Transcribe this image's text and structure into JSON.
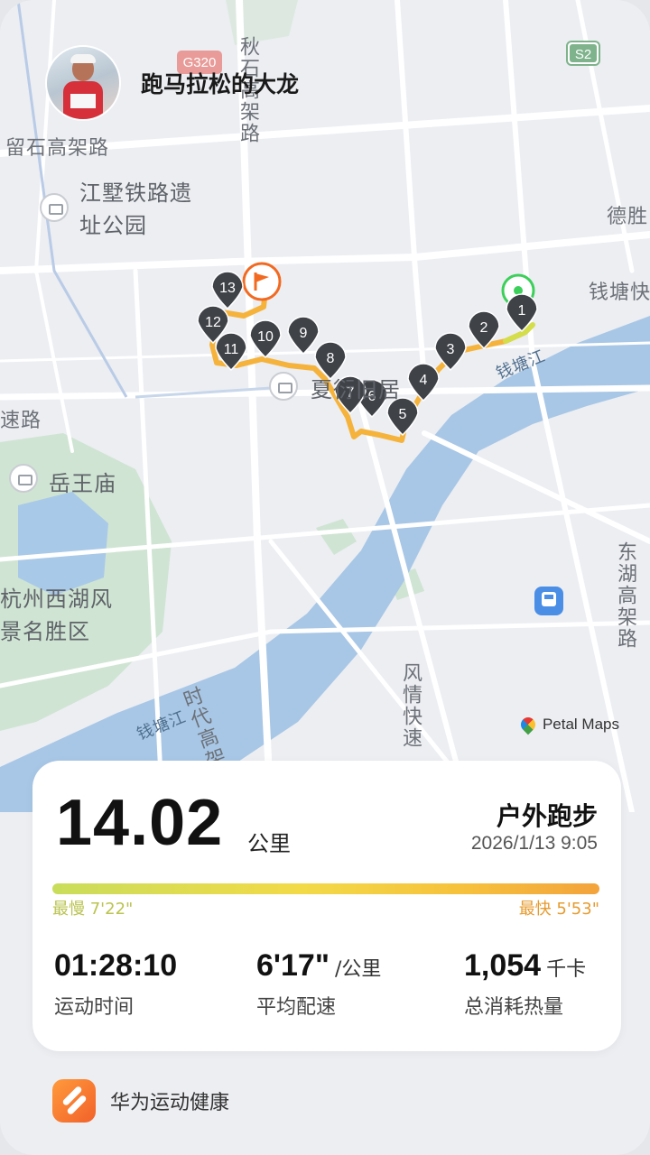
{
  "header": {
    "username": "跑马拉松的大龙"
  },
  "map": {
    "road_labels": [
      {
        "text": "留石高架路"
      },
      {
        "text": "德胜"
      },
      {
        "text": "钱塘快"
      },
      {
        "text": "速路"
      },
      {
        "text": "东湖高架路"
      },
      {
        "text": "风情快速"
      },
      {
        "text": "时代高架"
      },
      {
        "text": "秋石高架路"
      }
    ],
    "places": [
      {
        "text": "江墅铁路遗址公园"
      },
      {
        "text": "岳王庙"
      },
      {
        "text": "杭州西湖风景名胜区"
      },
      {
        "text": "夏衍旧居"
      }
    ],
    "river_labels": [
      "钱塘江",
      "钱塘江"
    ],
    "road_badges": [
      "S2",
      "G320"
    ],
    "km_markers": [
      "1",
      "2",
      "3",
      "4",
      "5",
      "6",
      "7",
      "8",
      "9",
      "10",
      "11",
      "12",
      "13"
    ],
    "attribution": "Petal Maps",
    "colors": {
      "route": "#f5b33c",
      "route_start": "#d4dd4a",
      "marker": "#3f4247",
      "finish": "#f26a21",
      "start": "#3ccf5a",
      "water": "#a8c7e6",
      "park": "#c9e3cf"
    }
  },
  "summary": {
    "distance": "14.02",
    "distance_unit": "公里",
    "activity_type": "户外跑步",
    "datetime": "2026/1/13 9:05",
    "slowest": "最慢 7'22\"",
    "fastest": "最快 5'53\"",
    "duration": "01:28:10",
    "duration_label": "运动时间",
    "pace": "6'17\"",
    "pace_unit": "/公里",
    "pace_label": "平均配速",
    "calories": "1,054",
    "calories_unit": "千卡",
    "calories_label": "总消耗热量"
  },
  "footer": {
    "app_name": "华为运动健康"
  }
}
